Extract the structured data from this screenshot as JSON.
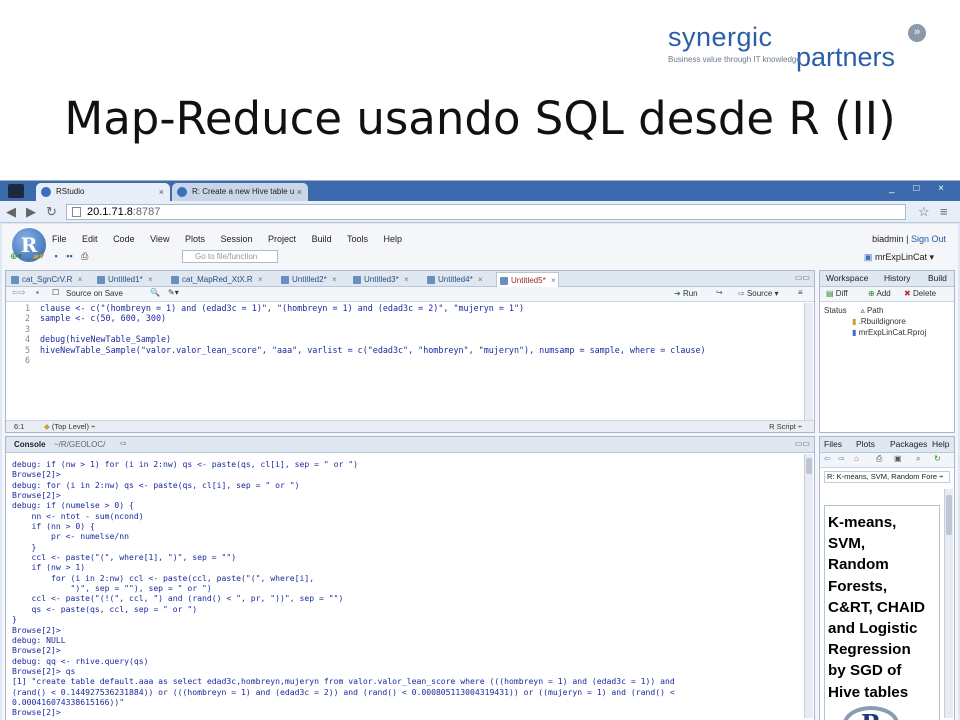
{
  "slide": {
    "title": "Map-Reduce usando SQL desde R (II)",
    "logo": {
      "word1": "synergic",
      "word2": "partners",
      "tagline": "Business value through IT knowledge",
      "chevron": "»"
    }
  },
  "browser": {
    "tabs": [
      {
        "label": "RStudio",
        "close": "×"
      },
      {
        "label": "R: Create a new Hive table u",
        "close": "×"
      }
    ],
    "window_buttons": "_ □ ×",
    "url_host": "20.1.71.8",
    "url_port": ":8787"
  },
  "rstudio": {
    "logo": "R",
    "menu": [
      "File",
      "Edit",
      "Code",
      "View",
      "Plots",
      "Session",
      "Project",
      "Build",
      "Tools",
      "Help"
    ],
    "user": "biadmin",
    "sign_out": "Sign Out",
    "goto_placeholder": "Go to file/function",
    "project": "mrExpLinCat",
    "editor": {
      "tabs": [
        {
          "label": "cat_SgnCrV.R",
          "close": "×"
        },
        {
          "label": "Untitled1*",
          "close": "×"
        },
        {
          "label": "cat_MapRed_XtX.R",
          "close": "×"
        },
        {
          "label": "Untitled2*",
          "close": "×"
        },
        {
          "label": "Untitled3*",
          "close": "×"
        },
        {
          "label": "Untitled4*",
          "close": "×"
        },
        {
          "label": "Untitled5*",
          "close": "×"
        }
      ],
      "toolbar": {
        "source_on_save": "Source on Save",
        "run": "Run",
        "source": "Source"
      },
      "line_numbers": [
        "1",
        "2",
        "3",
        "4",
        "5",
        "6"
      ],
      "code": "clause <- c(\"(hombreyn = 1) and (edad3c = 1)\", \"(hombreyn = 1) and (edad3c = 2)\", \"mujeryn = 1\")\nsample <- c(50, 600, 300)\n\ndebug(hiveNewTable_Sample)\nhiveNewTable_Sample(\"valor.valor_lean_score\", \"aaa\", varlist = c(\"edad3c\", \"hombreyn\", \"mujeryn\"), numsamp = sample, where = clause)\n",
      "status_pos": "6:1",
      "status_scope": "(Top Level) ÷",
      "status_type": "R Script ÷"
    },
    "console": {
      "title": "Console",
      "path": "~/R/GEOLOC/",
      "text": "debug: if (nw > 1) for (i in 2:nw) qs <- paste(qs, cl[i], sep = \" or \")\nBrowse[2]>\ndebug: for (i in 2:nw) qs <- paste(qs, cl[i], sep = \" or \")\nBrowse[2]>\ndebug: if (numelse > 0) {\n    nn <- ntot - sum(ncond)\n    if (nn > 0) {\n        pr <- numelse/nn\n    }\n    ccl <- paste(\"(\", where[1], \")\", sep = \"\")\n    if (nw > 1)\n        for (i in 2:nw) ccl <- paste(ccl, paste(\"(\", where[i],\n            \")\", sep = \"\"), sep = \" or \")\n    ccl <- paste(\"(!(\", ccl, \") and (rand() < \", pr, \"))\", sep = \"\")\n    qs <- paste(qs, ccl, sep = \" or \")\n}\nBrowse[2]>\ndebug: NULL\nBrowse[2]>\ndebug: qq <- rhive.query(qs)\nBrowse[2]> qs\n[1] \"create table default.aaa as select edad3c,hombreyn,mujeryn from valor.valor_lean_score where (((hombreyn = 1) and (edad3c = 1)) and\n(rand() < 0.144927536231884)) or (((hombreyn = 1) and (edad3c = 2)) and (rand() < 0.000805113004319431)) or ((mujeryn = 1) and (rand() <\n0.000416074338615166))\"\nBrowse[2]>"
    },
    "workspace": {
      "tabs": [
        "Workspace",
        "History",
        "Build"
      ],
      "tools": {
        "diff": "Diff",
        "add": "Add",
        "delete": "Delete"
      },
      "columns": {
        "status": "Status",
        "path": "Path"
      },
      "files": [
        ".Rbuildignore",
        "mrExpLinCat.Rproj"
      ]
    },
    "help": {
      "tabs": [
        "Files",
        "Plots",
        "Packages",
        "Help"
      ],
      "topic": "R: K-means, SVM, Random Fore ÷",
      "image_text": "K-means,\nSVM,\nRandom\nForests,\nC&RT, CHAID\nand Logistic\nRegression\nby SGD of\nHive tables",
      "r_logo": "R"
    }
  }
}
